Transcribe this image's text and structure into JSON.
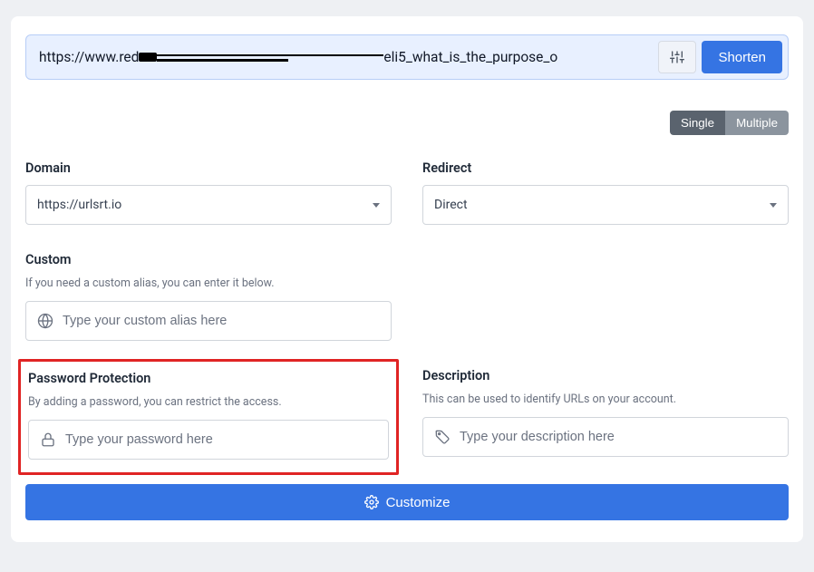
{
  "url_bar": {
    "prefix": "https://www.red",
    "suffix": "eli5_what_is_the_purpose_o",
    "shorten_label": "Shorten"
  },
  "toggle": {
    "single": "Single",
    "multiple": "Multiple"
  },
  "domain": {
    "label": "Domain",
    "selected": "https://urlsrt.io"
  },
  "redirect": {
    "label": "Redirect",
    "selected": "Direct"
  },
  "custom": {
    "label": "Custom",
    "help": "If you need a custom alias, you can enter it below.",
    "placeholder": "Type your custom alias here"
  },
  "password": {
    "label": "Password Protection",
    "help": "By adding a password, you can restrict the access.",
    "placeholder": "Type your password here"
  },
  "description": {
    "label": "Description",
    "help": "This can be used to identify URLs on your account.",
    "placeholder": "Type your description here"
  },
  "customize_label": "Customize"
}
